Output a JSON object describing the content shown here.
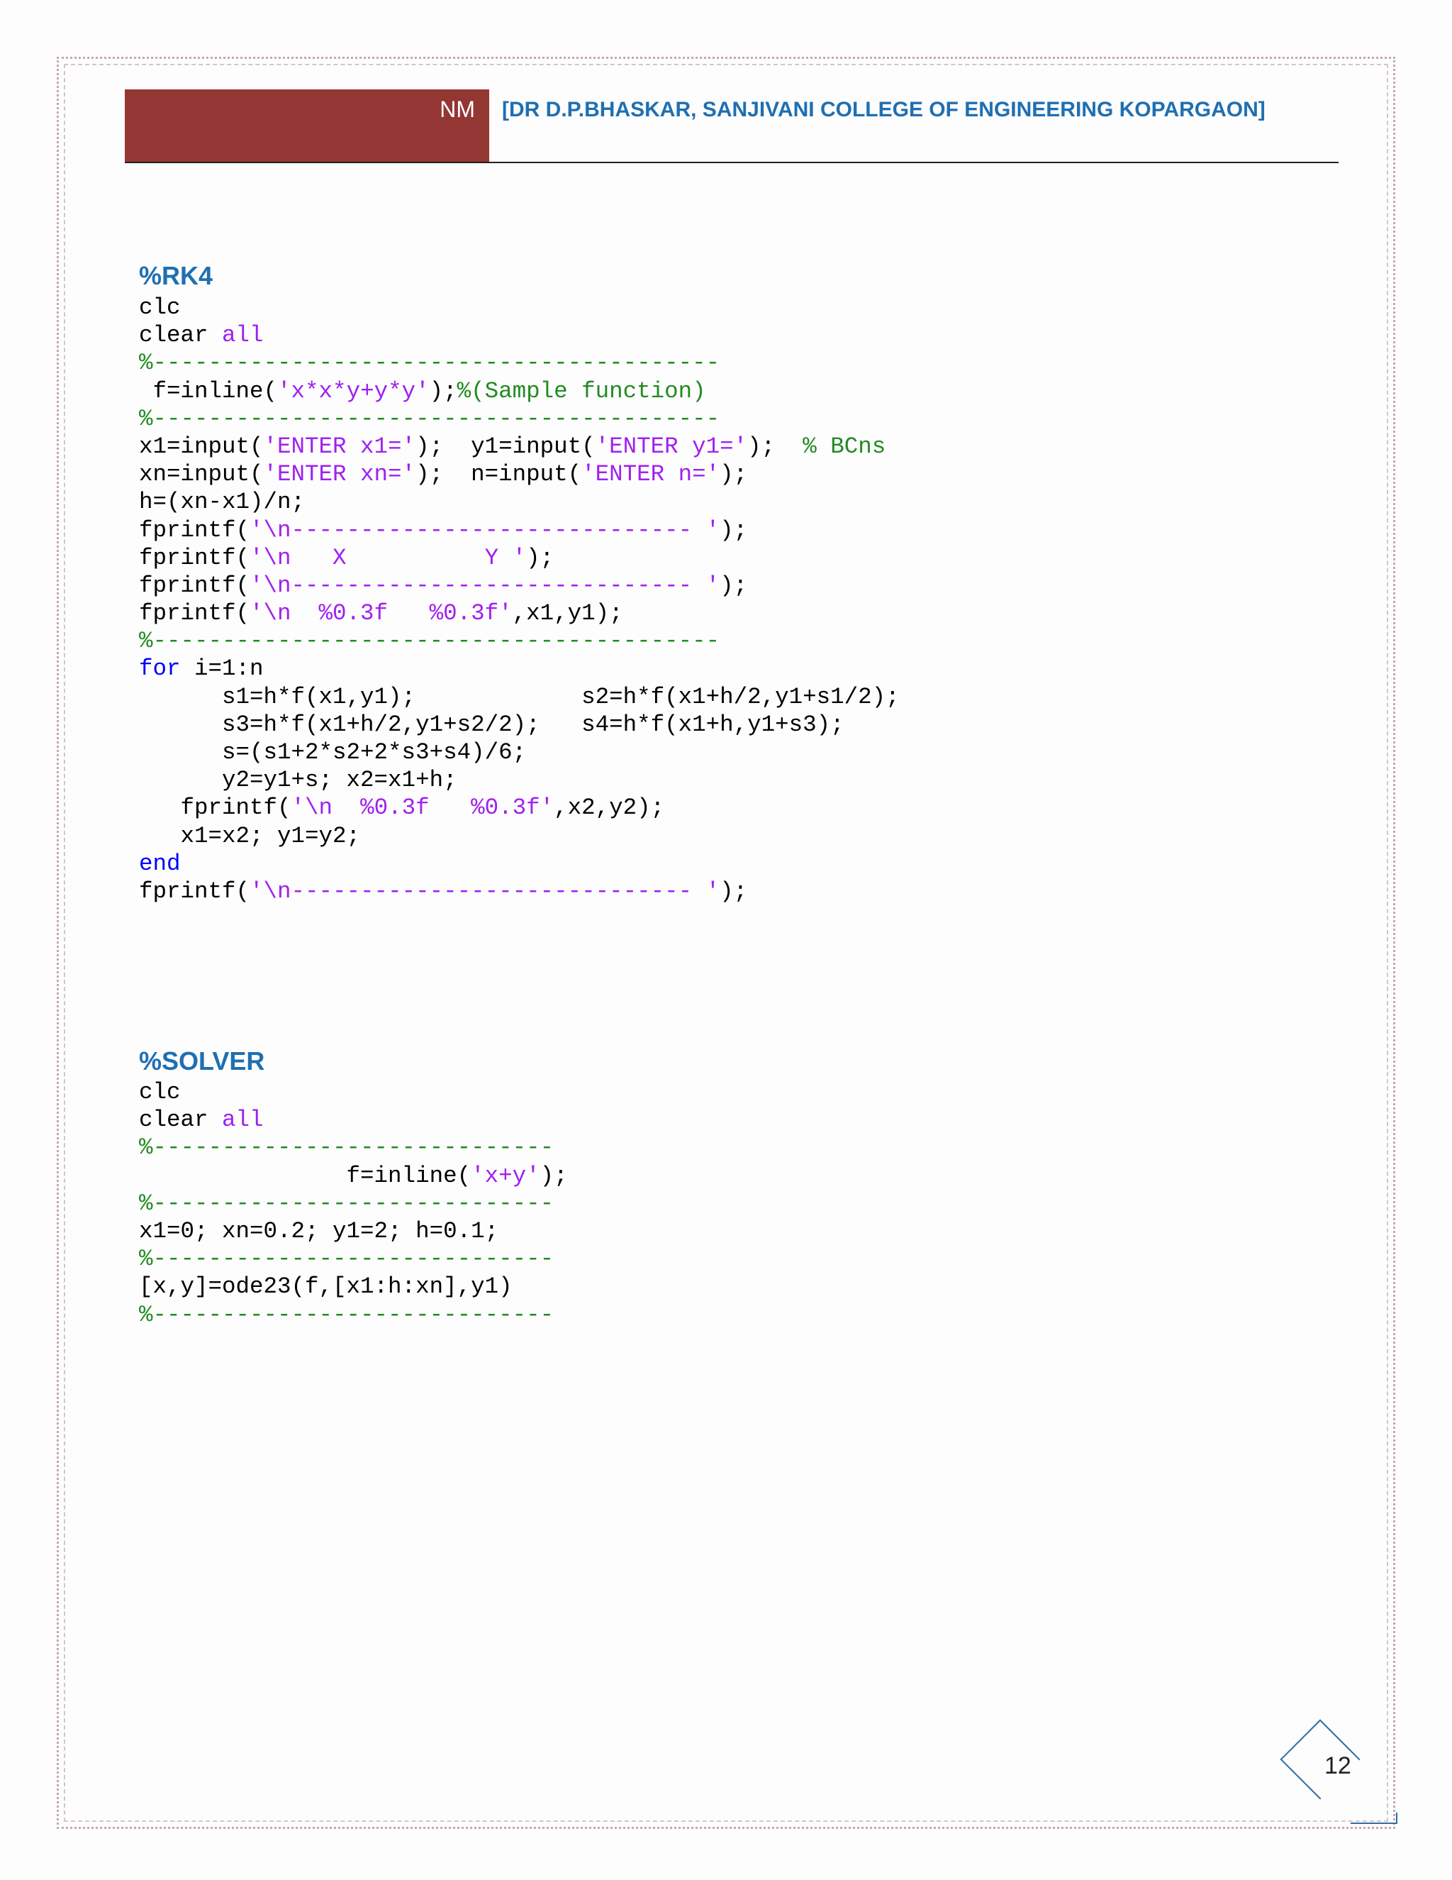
{
  "header": {
    "subject": "NM",
    "title": "[DR D.P.BHASKAR, SANJIVANI COLLEGE OF ENGINEERING KOPARGAON]"
  },
  "sections": [
    {
      "title": "%RK4",
      "lines": [
        [
          {
            "t": "clc",
            "c": ""
          }
        ],
        [
          {
            "t": "clear ",
            "c": ""
          },
          {
            "t": "all",
            "c": "s"
          }
        ],
        [
          {
            "t": "%-----------------------------------------",
            "c": "c"
          }
        ],
        [
          {
            "t": " f=inline(",
            "c": ""
          },
          {
            "t": "'x*x*y+y*y'",
            "c": "s"
          },
          {
            "t": ");",
            "c": ""
          },
          {
            "t": "%(Sample function)",
            "c": "c"
          }
        ],
        [
          {
            "t": "%-----------------------------------------",
            "c": "c"
          }
        ],
        [
          {
            "t": "x1=input(",
            "c": ""
          },
          {
            "t": "'ENTER x1='",
            "c": "s"
          },
          {
            "t": ");  y1=input(",
            "c": ""
          },
          {
            "t": "'ENTER y1='",
            "c": "s"
          },
          {
            "t": ");  ",
            "c": ""
          },
          {
            "t": "% BCns",
            "c": "c"
          }
        ],
        [
          {
            "t": "xn=input(",
            "c": ""
          },
          {
            "t": "'ENTER xn='",
            "c": "s"
          },
          {
            "t": ");  n=input(",
            "c": ""
          },
          {
            "t": "'ENTER n='",
            "c": "s"
          },
          {
            "t": ");",
            "c": ""
          }
        ],
        [
          {
            "t": "h=(xn-x1)/n;",
            "c": ""
          }
        ],
        [
          {
            "t": "fprintf(",
            "c": ""
          },
          {
            "t": "'\\n----------------------------- '",
            "c": "s"
          },
          {
            "t": ");",
            "c": ""
          }
        ],
        [
          {
            "t": "fprintf(",
            "c": ""
          },
          {
            "t": "'\\n   X          Y '",
            "c": "s"
          },
          {
            "t": ");",
            "c": ""
          }
        ],
        [
          {
            "t": "fprintf(",
            "c": ""
          },
          {
            "t": "'\\n----------------------------- '",
            "c": "s"
          },
          {
            "t": ");",
            "c": ""
          }
        ],
        [
          {
            "t": "fprintf(",
            "c": ""
          },
          {
            "t": "'\\n  %0.3f   %0.3f'",
            "c": "s"
          },
          {
            "t": ",x1,y1);",
            "c": ""
          }
        ],
        [
          {
            "t": "%-----------------------------------------",
            "c": "c"
          }
        ],
        [
          {
            "t": "for",
            "c": "k"
          },
          {
            "t": " i=1:n",
            "c": ""
          }
        ],
        [
          {
            "t": "      s1=h*f(x1,y1);            s2=h*f(x1+h/2,y1+s1/2);",
            "c": ""
          }
        ],
        [
          {
            "t": "      s3=h*f(x1+h/2,y1+s2/2);   s4=h*f(x1+h,y1+s3);",
            "c": ""
          }
        ],
        [
          {
            "t": "      s=(s1+2*s2+2*s3+s4)/6;",
            "c": ""
          }
        ],
        [
          {
            "t": "      y2=y1+s; x2=x1+h;",
            "c": ""
          }
        ],
        [
          {
            "t": "   fprintf(",
            "c": ""
          },
          {
            "t": "'\\n  %0.3f   %0.3f'",
            "c": "s"
          },
          {
            "t": ",x2,y2);",
            "c": ""
          }
        ],
        [
          {
            "t": "   x1=x2; y1=y2;",
            "c": ""
          }
        ],
        [
          {
            "t": "end",
            "c": "k"
          }
        ],
        [
          {
            "t": "fprintf(",
            "c": ""
          },
          {
            "t": "'\\n----------------------------- '",
            "c": "s"
          },
          {
            "t": ");",
            "c": ""
          }
        ]
      ]
    },
    {
      "title": "%SOLVER",
      "lines": [
        [
          {
            "t": "clc",
            "c": ""
          }
        ],
        [
          {
            "t": "clear ",
            "c": ""
          },
          {
            "t": "all",
            "c": "s"
          }
        ],
        [
          {
            "t": "%-----------------------------",
            "c": "c"
          }
        ],
        [
          {
            "t": "               f=inline(",
            "c": ""
          },
          {
            "t": "'x+y'",
            "c": "s"
          },
          {
            "t": ");",
            "c": ""
          }
        ],
        [
          {
            "t": "%-----------------------------",
            "c": "c"
          }
        ],
        [
          {
            "t": "x1=0; xn=0.2; y1=2; h=0.1;",
            "c": ""
          }
        ],
        [
          {
            "t": "%-----------------------------",
            "c": "c"
          }
        ],
        [
          {
            "t": "[x,y]=ode23(f,[x1:h:xn],y1)",
            "c": ""
          }
        ],
        [
          {
            "t": "%-----------------------------",
            "c": "c"
          }
        ]
      ]
    }
  ],
  "page_number": "12",
  "colors": {
    "header_block": "#943634",
    "heading_blue": "#1f6fb2",
    "keyword": "#0000ff",
    "string": "#a020f0",
    "comment": "#228b22"
  }
}
